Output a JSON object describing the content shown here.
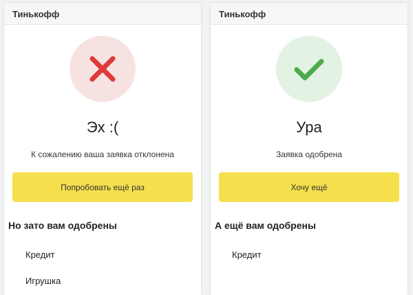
{
  "colors": {
    "rejected_circle": "#f7e2e2",
    "rejected_cross": "#df3a3a",
    "approved_circle": "#e3f2e3",
    "approved_check": "#4caa4a",
    "button": "#f5df4d"
  },
  "left_panel": {
    "title": "Тинькофф",
    "status_icon": "cross-icon",
    "heading": "Эх :(",
    "message": "К сожалению ваша заявка отклонена",
    "button_label": "Попробовать ещё раз",
    "section_title": "Но зато вам одобрены",
    "offers": [
      "Кредит",
      "Игрушка"
    ]
  },
  "right_panel": {
    "title": "Тинькофф",
    "status_icon": "checkmark-icon",
    "heading": "Ура",
    "message": "Заявка одобрена",
    "button_label": "Хочу ещё",
    "section_title": "А ещё вам одобрены",
    "offers": [
      "Кредит"
    ]
  }
}
